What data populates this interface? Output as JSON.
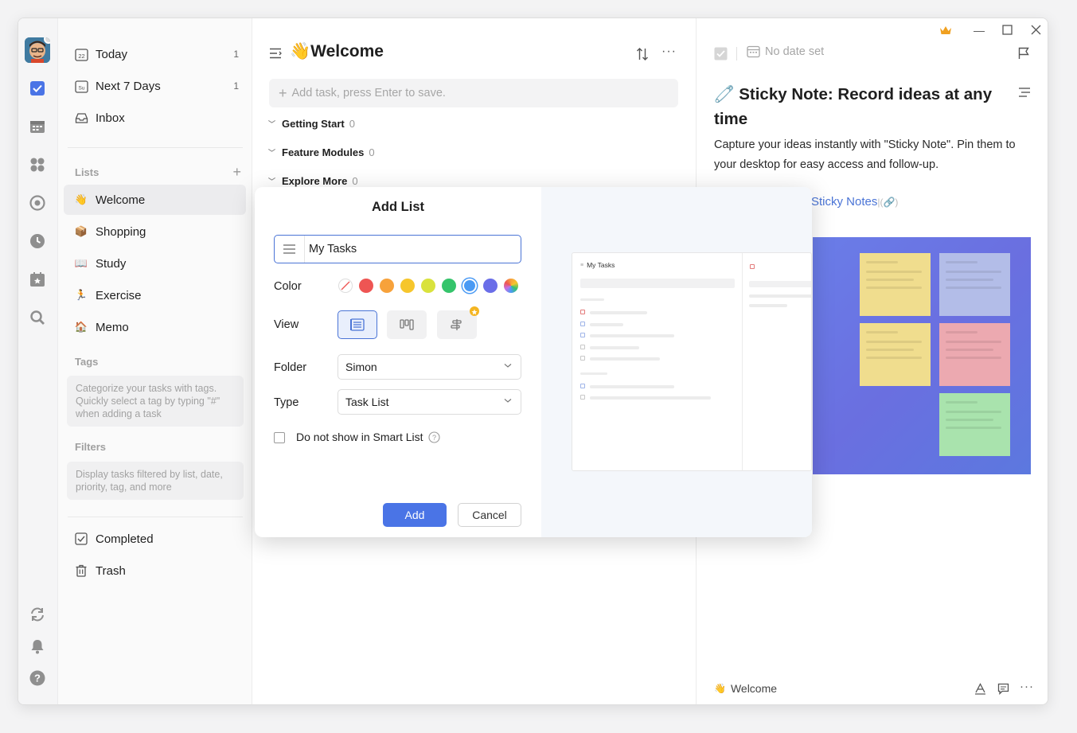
{
  "sidebar": {
    "smart": [
      {
        "label": "Today",
        "count": "1",
        "icon": "calendar-today-icon"
      },
      {
        "label": "Next 7 Days",
        "count": "1",
        "icon": "calendar-week-icon"
      },
      {
        "label": "Inbox",
        "count": "",
        "icon": "inbox-icon"
      }
    ],
    "lists_title": "Lists",
    "lists": [
      {
        "label": "Welcome",
        "emoji": "👋"
      },
      {
        "label": "Shopping",
        "emoji": "📦"
      },
      {
        "label": "Study",
        "emoji": "📖"
      },
      {
        "label": "Exercise",
        "emoji": "🏃"
      },
      {
        "label": "Memo",
        "emoji": "🏠"
      }
    ],
    "tags_title": "Tags",
    "tags_hint": "Categorize your tasks with tags. Quickly select a tag by typing \"#\" when adding a task",
    "filters_title": "Filters",
    "filters_hint": "Display tasks filtered by list, date, priority, tag, and more",
    "bottom": [
      {
        "label": "Completed"
      },
      {
        "label": "Trash"
      }
    ]
  },
  "main": {
    "title_emoji": "👋",
    "title": "Welcome",
    "add_placeholder": "Add task, press Enter to save.",
    "groups": [
      {
        "label": "Getting Start",
        "count": "0"
      },
      {
        "label": "Feature Modules",
        "count": "0"
      },
      {
        "label": "Explore More",
        "count": "0"
      }
    ]
  },
  "detail": {
    "date_label": "No date set",
    "title_emoji": "🧷",
    "title": "Sticky Note: Record ideas at any time",
    "body": "Capture your ideas instantly with \"Sticky Note\". Pin them to your desktop for easy access and follow-up.",
    "link_text": "Sticky Notes",
    "footer_list_emoji": "👋",
    "footer_list": "Welcome"
  },
  "modal": {
    "title": "Add List",
    "name_value": "My Tasks",
    "color_label": "Color",
    "colors": [
      "#ee5553",
      "#f7a23b",
      "#f6c62c",
      "#d9e23d",
      "#35c46b",
      "#4a9af4",
      "#6a6ee8"
    ],
    "selected_color": "#4a9af4",
    "view_label": "View",
    "folder_label": "Folder",
    "folder_value": "Simon",
    "type_label": "Type",
    "type_value": "Task List",
    "smart_list_label": "Do not show in Smart List",
    "add_label": "Add",
    "cancel_label": "Cancel",
    "preview_title": "My Tasks"
  }
}
